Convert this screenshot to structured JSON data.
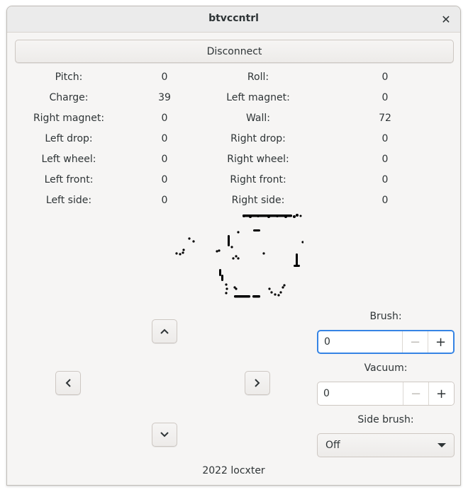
{
  "window": {
    "title": "btvccntrl",
    "close_glyph": "✕"
  },
  "disconnect_label": "Disconnect",
  "stats": {
    "pitch": {
      "label": "Pitch:",
      "value": "0"
    },
    "roll": {
      "label": "Roll:",
      "value": "0"
    },
    "charge": {
      "label": "Charge:",
      "value": "39"
    },
    "left_magnet": {
      "label": "Left magnet:",
      "value": "0"
    },
    "right_magnet": {
      "label": "Right magnet:",
      "value": "0"
    },
    "wall": {
      "label": "Wall:",
      "value": "72"
    },
    "left_drop": {
      "label": "Left drop:",
      "value": "0"
    },
    "right_drop": {
      "label": "Right drop:",
      "value": "0"
    },
    "left_wheel": {
      "label": "Left wheel:",
      "value": "0"
    },
    "right_wheel": {
      "label": "Right wheel:",
      "value": "0"
    },
    "left_front": {
      "label": "Left front:",
      "value": "0"
    },
    "right_front": {
      "label": "Right front:",
      "value": "0"
    },
    "left_side": {
      "label": "Left side:",
      "value": "0"
    },
    "right_side": {
      "label": "Right side:",
      "value": "0"
    }
  },
  "controls": {
    "up_icon": "chevron-up-icon",
    "down_icon": "chevron-down-icon",
    "left_icon": "chevron-left-icon",
    "right_icon": "chevron-right-icon"
  },
  "brush": {
    "label": "Brush:",
    "value": "0",
    "minus": "−",
    "plus": "+"
  },
  "vacuum": {
    "label": "Vacuum:",
    "value": "0",
    "minus": "−",
    "plus": "+"
  },
  "side_brush": {
    "label": "Side brush:",
    "selected": "Off"
  },
  "footer": "2022 locxter",
  "colors": {
    "focus": "#3584e4",
    "map_points": "#000000"
  }
}
